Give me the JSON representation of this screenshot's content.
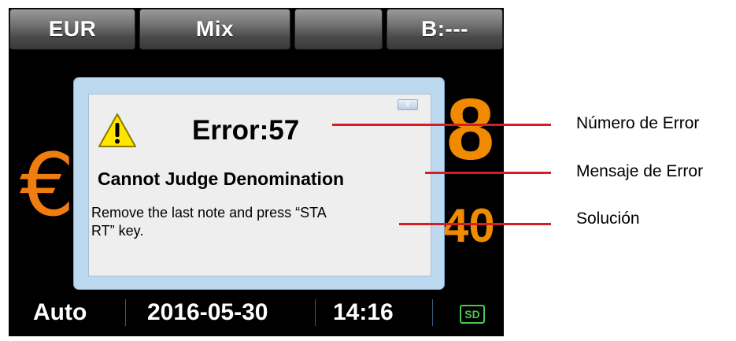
{
  "topbar": {
    "currency": "EUR",
    "mode": "Mix",
    "empty": "",
    "batch": "B:---"
  },
  "background": {
    "euro_symbol": "€",
    "count_digit": "8",
    "amount_digits": "40"
  },
  "dialog": {
    "close_glyph": "x",
    "error_number": "Error:57",
    "error_message": "Cannot Judge Denomination",
    "solution_line1": "Remove the last note and press “STA",
    "solution_line2": "RT” key."
  },
  "statusbar": {
    "mode": "Auto",
    "date": "2016-05-30",
    "time": "14:16",
    "sd_label": "SD"
  },
  "annotations": {
    "error_number_label": "Número de Error",
    "error_message_label": "Mensaje de Error",
    "solution_label": "Solución"
  },
  "colors": {
    "annotation_line": "#d31f24",
    "digits": "#f08a00",
    "sd_indicator": "#4fc34f",
    "dialog_frame": "#bcd9f0"
  }
}
